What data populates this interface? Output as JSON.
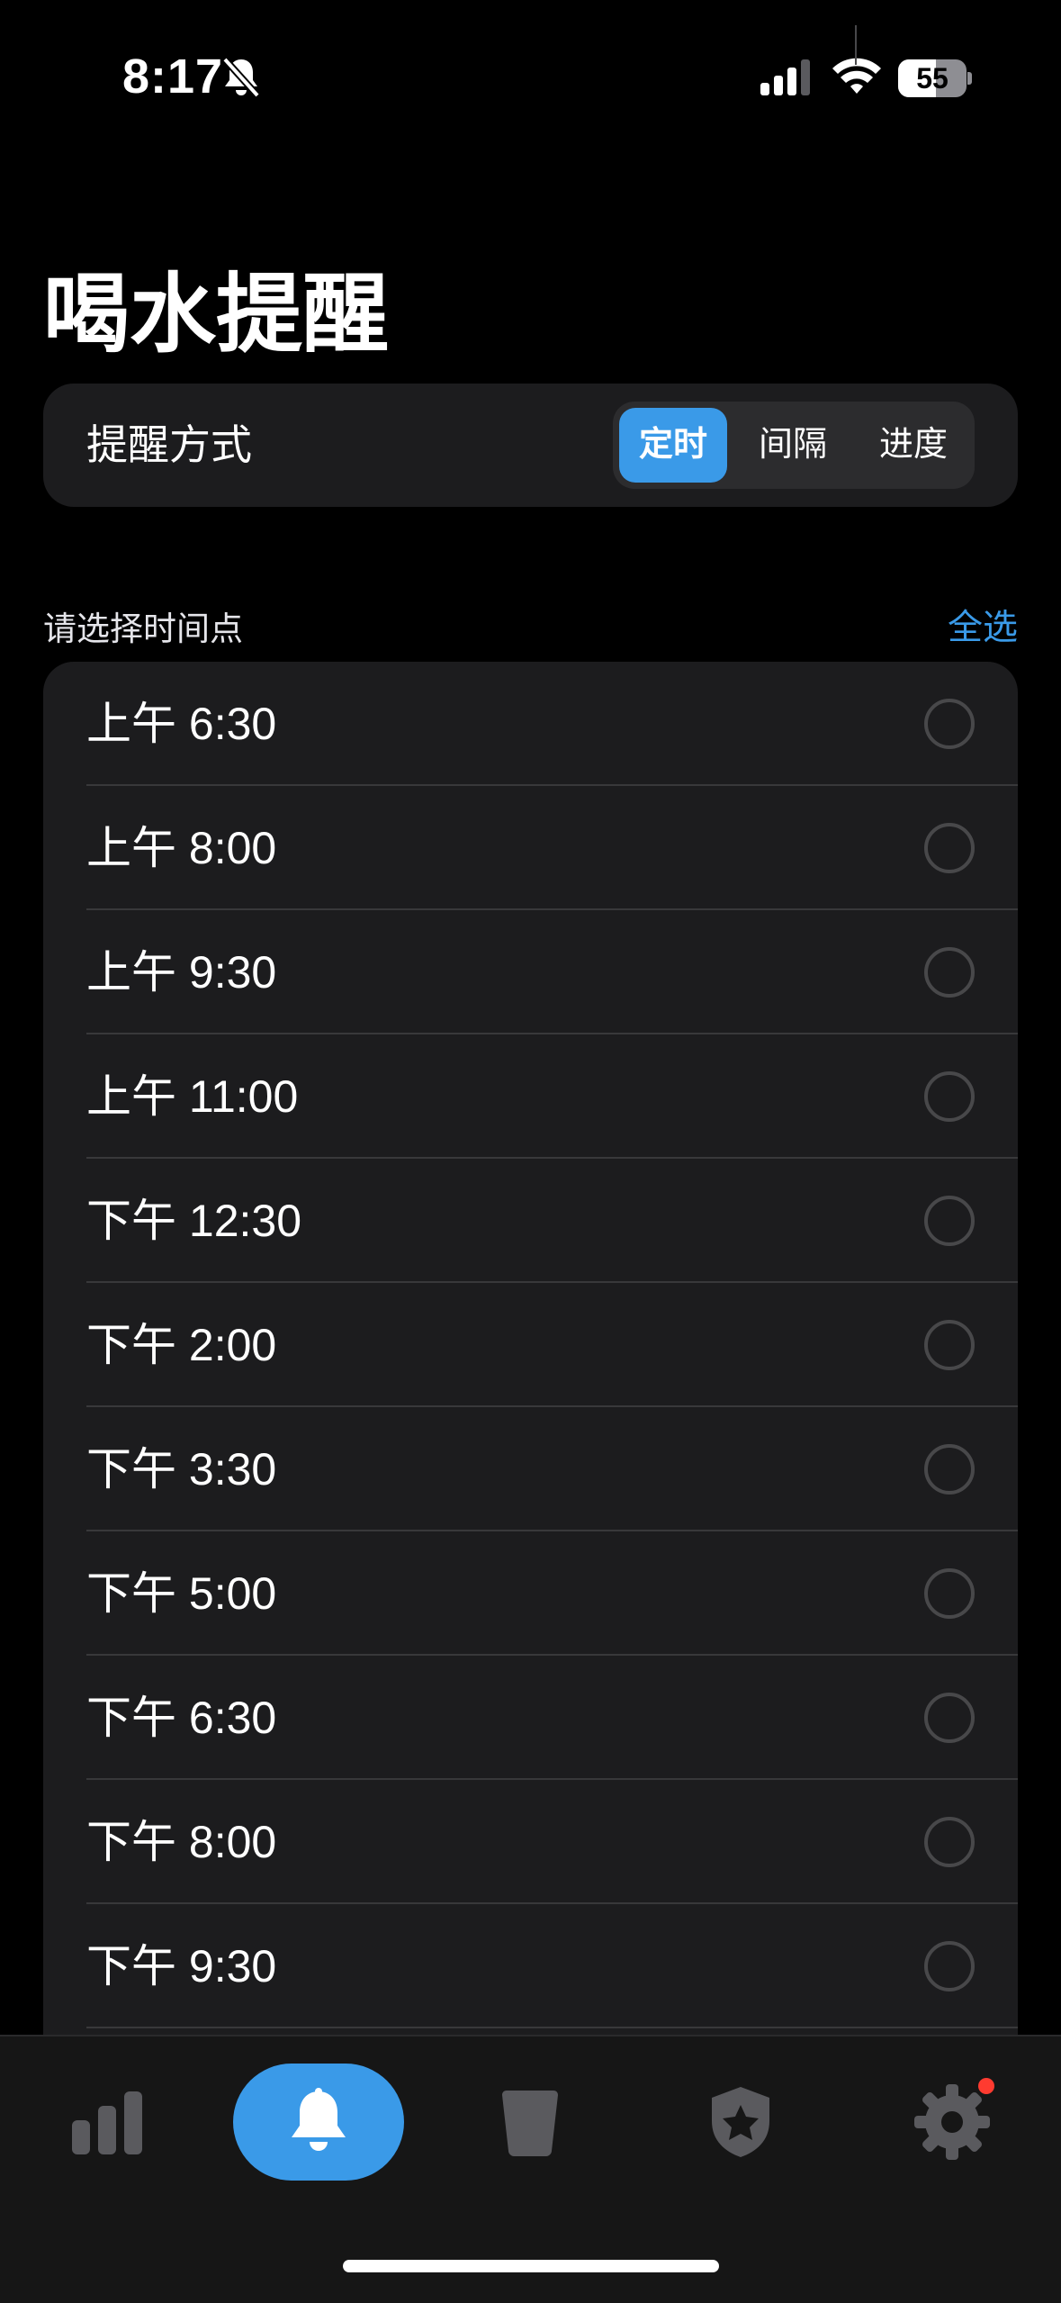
{
  "status_bar": {
    "time": "8:17",
    "battery": "55",
    "battery_fraction": 0.55
  },
  "page": {
    "title": "喝水提醒"
  },
  "mode": {
    "label": "提醒方式",
    "options": [
      "定时",
      "间隔",
      "进度"
    ],
    "selected": "定时"
  },
  "section": {
    "header": "请选择时间点",
    "select_all": "全选"
  },
  "times": [
    "上午 6:30",
    "上午 8:00",
    "上午 9:30",
    "上午 11:00",
    "下午 12:30",
    "下午 2:00",
    "下午 3:30",
    "下午 5:00",
    "下午 6:30",
    "下午 8:00",
    "下午 9:30"
  ],
  "tabs": [
    {
      "icon": "bar-chart-icon",
      "active": false
    },
    {
      "icon": "bell-icon",
      "active": true
    },
    {
      "icon": "cup-icon",
      "active": false
    },
    {
      "icon": "shield-star-icon",
      "active": false
    },
    {
      "icon": "gear-icon",
      "active": false,
      "badge": true
    }
  ],
  "colors": {
    "accent": "#3a9ae8",
    "background": "#000000",
    "card": "#1c1c1e",
    "badge": "#ff3b30"
  }
}
